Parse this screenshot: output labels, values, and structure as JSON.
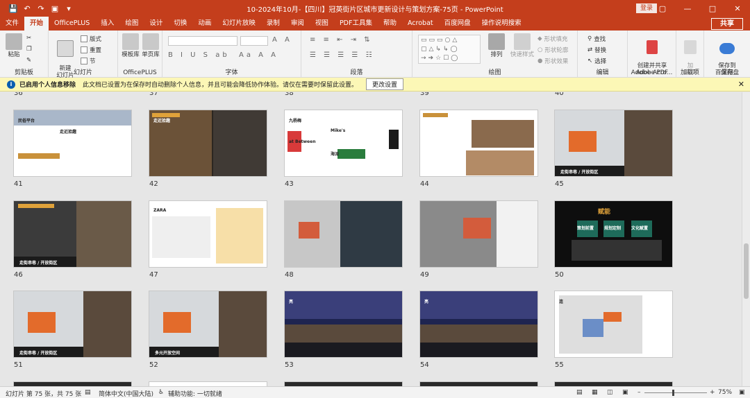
{
  "window": {
    "title": "10-2024年10月-【四川】冠英街片区城市更新设计与策划方案-75页  -  PowerPoint",
    "login_label": "登录",
    "quick_access": [
      "save-icon",
      "undo-icon",
      "redo-icon",
      "present-icon",
      "more-icon"
    ]
  },
  "tabs": [
    "文件",
    "开始",
    "OfficePLUS",
    "插入",
    "绘图",
    "设计",
    "切换",
    "动画",
    "幻灯片放映",
    "录制",
    "审阅",
    "视图",
    "PDF工具集",
    "帮助",
    "Acrobat",
    "百度网盘",
    "操作说明搜索"
  ],
  "active_tab": "开始",
  "share_label": "共享",
  "ribbon": {
    "clipboard": {
      "label": "剪贴板",
      "paste": "粘贴"
    },
    "slides": {
      "label": "幻灯片",
      "new_slide": "新建\n幻灯片",
      "layout": "版式",
      "reset": "重置",
      "section": "节"
    },
    "officeplus": {
      "label": "OfficePLUS",
      "template": "模板库",
      "single": "单页库"
    },
    "font": {
      "label": "字体"
    },
    "paragraph": {
      "label": "段落"
    },
    "drawing": {
      "label": "绘图",
      "arrange": "排列",
      "quick_styles": "快速样式",
      "fill": "形状填充",
      "outline": "形状轮廓",
      "effects": "形状效果"
    },
    "editing": {
      "label": "编辑",
      "find": "查找",
      "replace": "替换",
      "select": "选择"
    },
    "adobe": {
      "label": "Adobe Acro...",
      "btn": "创建并共享\nAdobe PDF"
    },
    "addins": {
      "label": "加载项",
      "btn": "加\n载项"
    },
    "save": {
      "label": "保存",
      "btn": "保存到\n百度网盘"
    }
  },
  "infobar": {
    "title": "已启用个人信息移除",
    "message": "此文档已设置为在保存时自动删除个人信息，并且可能会降低协作体验。请仅在需要时保留此设置。",
    "button": "更改设置"
  },
  "top_partial_numbers": [
    "36",
    "37",
    "38",
    "39",
    "40"
  ],
  "slides": [
    {
      "n": "41",
      "theme": "light",
      "labels": [
        "民俗平台",
        "走近拾趣"
      ]
    },
    {
      "n": "42",
      "theme": "darkphoto",
      "labels": [
        "走近拾趣"
      ]
    },
    {
      "n": "43",
      "theme": "logos",
      "labels": [
        "九杨梅",
        "Mike's",
        "at Between",
        "海派"
      ]
    },
    {
      "n": "44",
      "theme": "lightphoto",
      "labels": [
        "开始众筹"
      ]
    },
    {
      "n": "45",
      "theme": "map",
      "labels": [
        "走街串巷 / 开放街区"
      ]
    },
    {
      "n": "46",
      "theme": "mixed",
      "labels": [
        "走街串巷 / 开放街区"
      ]
    },
    {
      "n": "47",
      "theme": "diagram",
      "labels": [
        "ZARA"
      ]
    },
    {
      "n": "48",
      "theme": "plan",
      "labels": []
    },
    {
      "n": "49",
      "theme": "greyplan",
      "labels": []
    },
    {
      "n": "50",
      "theme": "black",
      "labels": [
        "赋能",
        "策划前置",
        "规划定制",
        "文化赋置"
      ]
    },
    {
      "n": "51",
      "theme": "map",
      "labels": [
        "走街串巷 / 开放街区"
      ]
    },
    {
      "n": "52",
      "theme": "map",
      "labels": [
        "多元开放空间"
      ]
    },
    {
      "n": "53",
      "theme": "night",
      "labels": [
        "亮"
      ]
    },
    {
      "n": "54",
      "theme": "night",
      "labels": [
        "亮"
      ]
    },
    {
      "n": "55",
      "theme": "whiteplan",
      "labels": [
        "连"
      ]
    }
  ],
  "status": {
    "slide_info": "幻灯片 第 75 张，共 75 张",
    "language": "简体中文(中国大陆)",
    "accessibility": "辅助功能: 一切就绪",
    "zoom": "75%"
  }
}
